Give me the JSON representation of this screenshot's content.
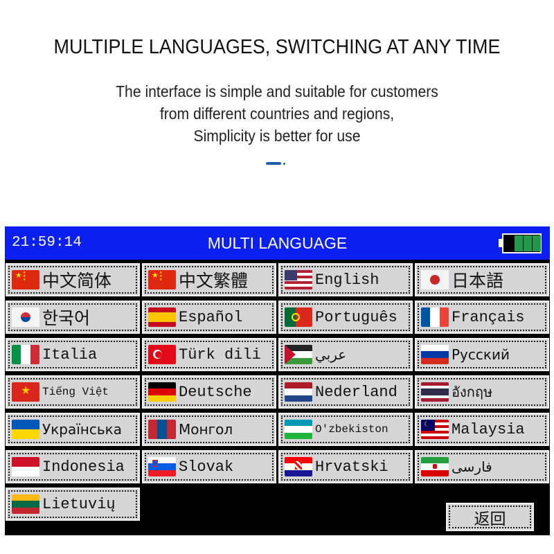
{
  "promo": {
    "headline": "MULTIPLE LANGUAGES, SWITCHING AT ANY TIME",
    "subtext_lines": [
      "The interface is simple and suitable for customers",
      "from different countries and regions,",
      "Simplicity is better for use"
    ],
    "accent_color": "#1f5fa6"
  },
  "device": {
    "titlebar": {
      "clock": "21:59:14",
      "title": "MULTI LANGUAGE",
      "battery_level": "3/3 bars",
      "bar_color": "#0a1ff0"
    },
    "languages": [
      {
        "label": "中文简体",
        "flag": "china-flag-icon",
        "style": "cjk"
      },
      {
        "label": "中文繁體",
        "flag": "china-flag-icon",
        "style": "cjk"
      },
      {
        "label": "English",
        "flag": "usa-flag-icon",
        "style": "mono"
      },
      {
        "label": "日本語",
        "flag": "japan-flag-icon",
        "style": "cjk"
      },
      {
        "label": "한국어",
        "flag": "korea-flag-icon",
        "style": "cjk"
      },
      {
        "label": "Español",
        "flag": "spain-flag-icon",
        "style": "mono"
      },
      {
        "label": "Português",
        "flag": "portugal-flag-icon",
        "style": "mono"
      },
      {
        "label": "Français",
        "flag": "france-flag-icon",
        "style": "mono"
      },
      {
        "label": "Italia",
        "flag": "italy-flag-icon",
        "style": "mono"
      },
      {
        "label": "Türk dili",
        "flag": "turkey-flag-icon",
        "style": "mono"
      },
      {
        "label": "عربي",
        "flag": "arabic-flag-icon",
        "style": "sans"
      },
      {
        "label": "Русский",
        "flag": "russia-flag-icon",
        "style": "sans"
      },
      {
        "label": "Tiếng Việt",
        "flag": "vietnam-flag-icon",
        "style": "small"
      },
      {
        "label": "Deutsche",
        "flag": "germany-flag-icon",
        "style": "mono"
      },
      {
        "label": "Nederland",
        "flag": "netherlands-flag-icon",
        "style": "mono"
      },
      {
        "label": "อังกฤษ",
        "flag": "thailand-flag-icon",
        "style": "sans"
      },
      {
        "label": "Українська",
        "flag": "ukraine-flag-icon",
        "style": "sans"
      },
      {
        "label": "Монгол",
        "flag": "mongolia-flag-icon",
        "style": "sans"
      },
      {
        "label": "O'zbekiston",
        "flag": "uzbekistan-flag-icon",
        "style": "small"
      },
      {
        "label": "Malaysia",
        "flag": "malaysia-flag-icon",
        "style": "mono"
      },
      {
        "label": "Indonesia",
        "flag": "indonesia-flag-icon",
        "style": "mono"
      },
      {
        "label": "Slovak",
        "flag": "slovenia-flag-icon",
        "style": "mono"
      },
      {
        "label": "Hrvatski",
        "flag": "croatia-flag-icon",
        "style": "mono"
      },
      {
        "label": "فارسی",
        "flag": "iran-flag-icon",
        "style": "sans"
      },
      {
        "label": "Lietuvių",
        "flag": "lithuania-flag-icon",
        "style": "mono"
      }
    ],
    "back_label": "返回"
  }
}
